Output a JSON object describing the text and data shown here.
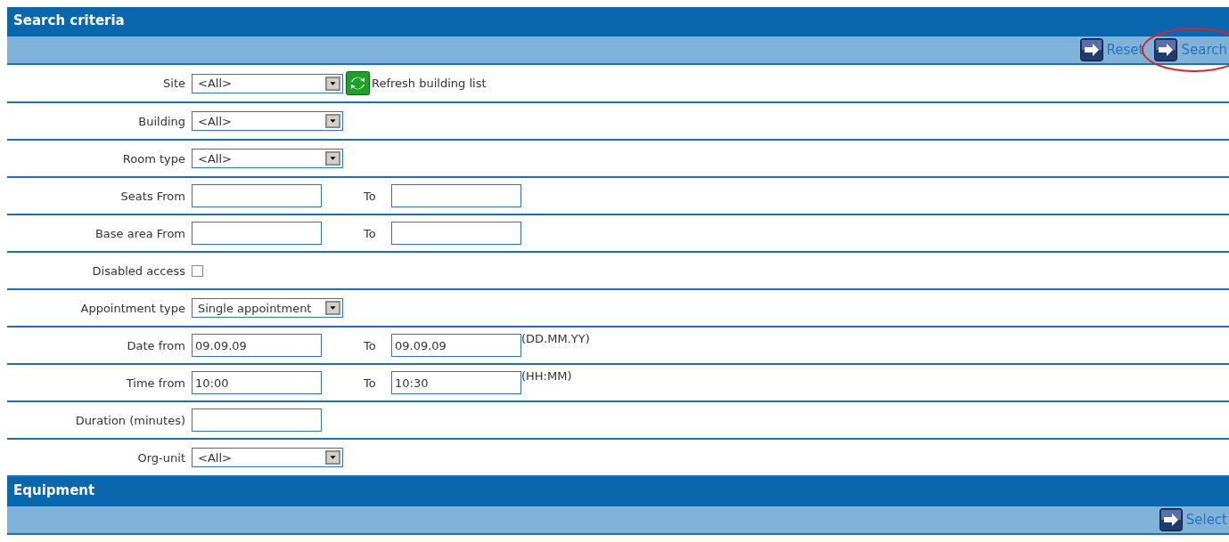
{
  "sections": [
    {
      "title": "Search criteria",
      "actions": [
        {
          "label": "Reset",
          "circled": false
        },
        {
          "label": "Search",
          "circled": true
        }
      ],
      "fields": [
        {
          "kind": "select",
          "label": "Site",
          "value": "<All>",
          "link": "Refresh building list"
        },
        {
          "kind": "select",
          "label": "Building",
          "value": "<All>"
        },
        {
          "kind": "select",
          "label": "Room type",
          "value": "<All>"
        },
        {
          "kind": "range",
          "label": "Seats From",
          "to_label": "To"
        },
        {
          "kind": "range",
          "label": "Base area From",
          "to_label": "To"
        },
        {
          "kind": "checkbox",
          "label": "Disabled access",
          "checked": false
        },
        {
          "kind": "select",
          "label": "Appointment type",
          "value": "Single appointment"
        },
        {
          "kind": "range",
          "label": "Date from",
          "to_label": "To",
          "from": "09.09.09",
          "to": "09.09.09",
          "hint": "(DD.MM.YY)"
        },
        {
          "kind": "range",
          "label": "Time from",
          "to_label": "To",
          "from": "10:00",
          "to": "10:30",
          "hint": "(HH:MM)"
        },
        {
          "kind": "text",
          "label": "Duration (minutes)"
        },
        {
          "kind": "select",
          "label": "Org-unit",
          "value": "<All>"
        }
      ]
    },
    {
      "title": "Equipment",
      "actions": [
        {
          "label": "Select",
          "circled": false
        }
      ]
    }
  ]
}
